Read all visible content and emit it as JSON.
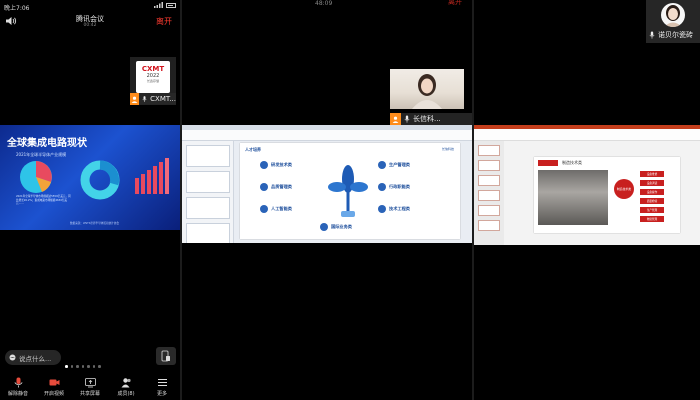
{
  "status_bar": {
    "time": "晚上7:06"
  },
  "meeting": {
    "title": "腾讯会议",
    "subtitle": "00:42",
    "leave_label": "离开",
    "timer": "48:09",
    "top_right_label": "离开"
  },
  "participants": {
    "cxmt": {
      "name": "CXMT...",
      "logo_line1": "CXMT",
      "logo_line2": "2022",
      "logo_line3": "长鑫存储"
    },
    "changxin": {
      "name": "长信科..."
    },
    "nuobeier": {
      "name": "诺贝尔瓷砖"
    }
  },
  "shared_slide": {
    "title": "全球集成电路现状",
    "subtitle": "2021年全球半导体产业规模",
    "notes": "2021年全球半导体市场规模达5559亿美元，同比增长26.2%；集成电路市场规模4630亿美元……",
    "footer": "数据来源：WSTS世界半导体贸易统计协会"
  },
  "chat": {
    "placeholder": "说点什么..."
  },
  "toolbar": {
    "items": [
      {
        "label": "解除静音",
        "icon": "mic-muted-icon"
      },
      {
        "label": "开启视频",
        "icon": "camera-icon"
      },
      {
        "label": "共享屏幕",
        "icon": "share-screen-icon"
      },
      {
        "label": "成员(8)",
        "icon": "members-icon"
      },
      {
        "label": "更多",
        "icon": "more-icon"
      }
    ]
  },
  "word_doc": {
    "page_title": "人才培养",
    "logo": "长信科技",
    "tags": [
      "研发技术类",
      "生产管理类",
      "品质管理类",
      "行政职能类",
      "人工智能类",
      "技术工程类",
      "国际业务类"
    ]
  },
  "ppt": {
    "slide_title": "制造技术类",
    "side_label": "制造技术类",
    "buttons": [
      "设备维修",
      "设备调试",
      "设备操作",
      "质量检验",
      "生产管理",
      "物流管理"
    ]
  },
  "colors": {
    "leave": "#ff3b30",
    "accent_orange": "#ff8c1a",
    "slide_blue": "#1c52d0",
    "ppt_red": "#c8201f"
  }
}
